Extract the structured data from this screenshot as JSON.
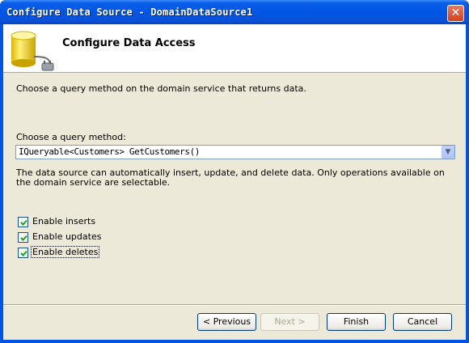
{
  "window": {
    "title": "Configure Data Source - DomainDataSource1",
    "close_glyph": "✕"
  },
  "header": {
    "title": "Configure Data Access",
    "icon": "database-plug-icon"
  },
  "main": {
    "description": "Choose a query method on the domain service that returns data.",
    "query_label": "Choose a query method:",
    "query_value": "IQueryable<Customers> GetCustomers()",
    "operations_text": "The data source can automatically insert, update, and delete data. Only operations available on the domain service are selectable.",
    "checkboxes": [
      {
        "label": "Enable inserts",
        "checked": true
      },
      {
        "label": "Enable updates",
        "checked": true
      },
      {
        "label": "Enable deletes",
        "checked": true
      }
    ]
  },
  "footer": {
    "previous_label": "< Previous",
    "next_label": "Next >",
    "finish_label": "Finish",
    "cancel_label": "Cancel"
  },
  "colors": {
    "titlebar": "#0055e5",
    "client_bg": "#ece9d8",
    "check_green": "#21a121"
  }
}
